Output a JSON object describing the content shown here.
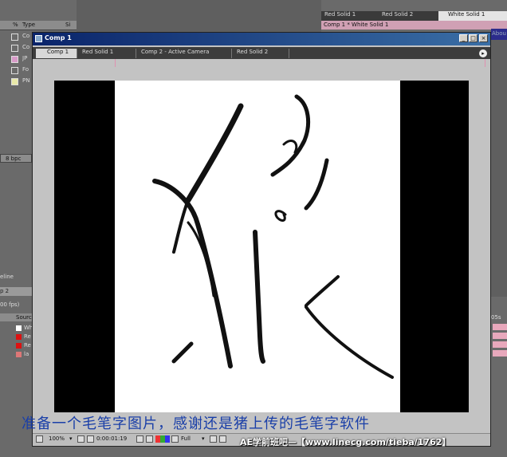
{
  "project": {
    "columns": {
      "icon_col": "%",
      "type": "Type",
      "size": "Si"
    },
    "items": [
      {
        "label": "Co",
        "color": "#6a6a6a"
      },
      {
        "label": "Co",
        "color": "#6a6a6a"
      },
      {
        "label": "JP",
        "color": "#d89ac8"
      },
      {
        "label": "Fo",
        "color": "#6a6a6a"
      },
      {
        "label": "PN",
        "color": "#e8e8a8"
      }
    ],
    "bpc": "8 bpc"
  },
  "timeline": {
    "title": "eline",
    "tab": "p 2",
    "fps": "00 fps)",
    "source_header": "Sourc",
    "rows": [
      {
        "label": "Whi",
        "color": "#ffffff"
      },
      {
        "label": "Re",
        "color": "#dd1111"
      },
      {
        "label": "Re",
        "color": "#dd1111"
      },
      {
        "label": "la",
        "color": "#dd7777"
      }
    ],
    "right_label": "05s"
  },
  "layer_panel": {
    "tabs": [
      "Red Solid 1",
      "Red Solid 2",
      "White Solid 1"
    ],
    "active_tab": "White Solid 1",
    "path": "Comp 1 * White Solid 1",
    "about": "Abou"
  },
  "comp_window": {
    "title": "Comp 1",
    "buttons": {
      "minimize": "_",
      "maximize": "□",
      "close": "×"
    },
    "tabs": [
      "Comp 1",
      "Red Solid 1",
      "Comp 2 - Active Camera",
      "Red Solid 2"
    ],
    "active_tab": "Comp 1",
    "tab_menu": "▸"
  },
  "viewer": {
    "zoom": "100%",
    "timecode": "0:00:01:19",
    "resolution": "Full",
    "subtitle": "准备一个毛笔字图片，感谢还是猪上传的毛笔字软件",
    "watermark": "AE学前班吧—【www.linecg.com/tieba/1762】"
  },
  "colors": {
    "title_gradient_start": "#0a246a",
    "title_gradient_end": "#3a6ea5",
    "subtitle": "#1a3fa8",
    "ink": "#111111"
  }
}
